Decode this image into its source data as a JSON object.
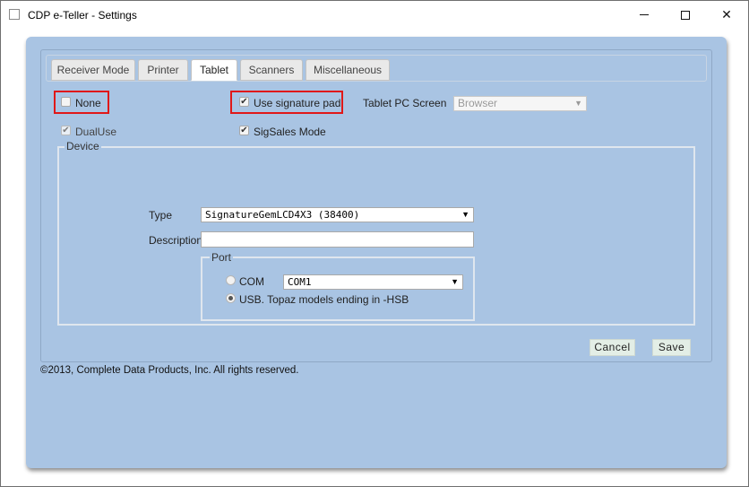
{
  "window": {
    "title": "CDP e-Teller - Settings",
    "minimize": "—",
    "maximize": "□",
    "close": "✕"
  },
  "tabs": [
    {
      "label": "Receiver Mode",
      "active": false
    },
    {
      "label": "Printer",
      "active": false
    },
    {
      "label": "Tablet",
      "active": true
    },
    {
      "label": "Scanners",
      "active": false
    },
    {
      "label": "Miscellaneous",
      "active": false
    }
  ],
  "tablet": {
    "none": {
      "label": "None",
      "checked": false
    },
    "use_signature_pad": {
      "label": "Use signature pad",
      "checked": true
    },
    "tablet_pc_screen": {
      "label": "Tablet PC Screen",
      "value": "Browser",
      "disabled": true
    },
    "dual_use": {
      "label": "DualUse",
      "checked": true,
      "disabled": true
    },
    "sigsales_mode": {
      "label": "SigSales Mode",
      "checked": true
    },
    "device": {
      "legend": "Device",
      "type_label": "Type",
      "type_value": "SignatureGemLCD4X3 (38400)",
      "description_label": "Description",
      "description_value": "",
      "port": {
        "legend": "Port",
        "com_label": "COM",
        "com_value": "COM1",
        "usb_label": "USB. Topaz models ending in -HSB",
        "selected": "usb"
      }
    }
  },
  "buttons": {
    "cancel": "Cancel",
    "save": "Save"
  },
  "footer": {
    "copyright": "©2013, Complete Data Products, Inc. All rights reserved."
  },
  "icons": {
    "checkmark": "✔",
    "dropdown": "▼"
  }
}
